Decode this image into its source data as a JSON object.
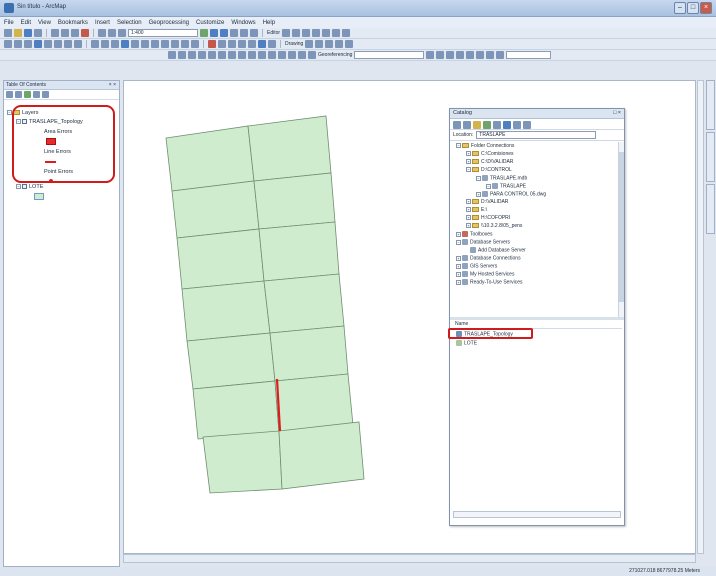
{
  "window": {
    "title": "Sin título - ArcMap"
  },
  "menu": [
    "File",
    "Edit",
    "View",
    "Bookmarks",
    "Insert",
    "Selection",
    "Geoprocessing",
    "Customize",
    "Windows",
    "Help"
  ],
  "toolbars": {
    "scale": "1:400",
    "editor_label": "Editor",
    "drawing_label": "Drawing",
    "georef_label": "Georeferencing"
  },
  "toc": {
    "title": "Table Of Contents",
    "items": [
      {
        "label": "Layers"
      },
      {
        "label": "TRASLAPE_Topology"
      },
      {
        "label": "Area Errors"
      },
      {
        "label": "Line Errors"
      },
      {
        "label": "Point Errors"
      },
      {
        "label": "LOTE"
      }
    ]
  },
  "catalog": {
    "title": "Catalog",
    "location_label": "Location:",
    "location_value": "TRASLAPE",
    "tree": [
      "Folder Connections",
      "C:\\Comisiones",
      "C:\\D\\VALIDAR",
      "D:\\CONTROL",
      "TRASLAPE.mdb",
      "TRASLAPE",
      "PARA CONTROL 05.dwg",
      "D:\\VALIDAR",
      "E:\\",
      "H:\\COFOPRI",
      "\\\\10.3.2.8\\05_pens",
      "Toolboxes",
      "Database Servers",
      "Add Database Server",
      "Database Connections",
      "GIS Servers",
      "My Hosted Services",
      "Ready-To-Use Services"
    ],
    "contents_header": "Name",
    "contents": [
      "TRASLAPE_Topology",
      "LOTE"
    ]
  },
  "status": {
    "coords": "271027.018  8677978.25 Meters"
  },
  "colors": {
    "parcel_fill": "#cfeccf",
    "error_line": "#e01b1b",
    "highlight": "#d11a1a"
  }
}
